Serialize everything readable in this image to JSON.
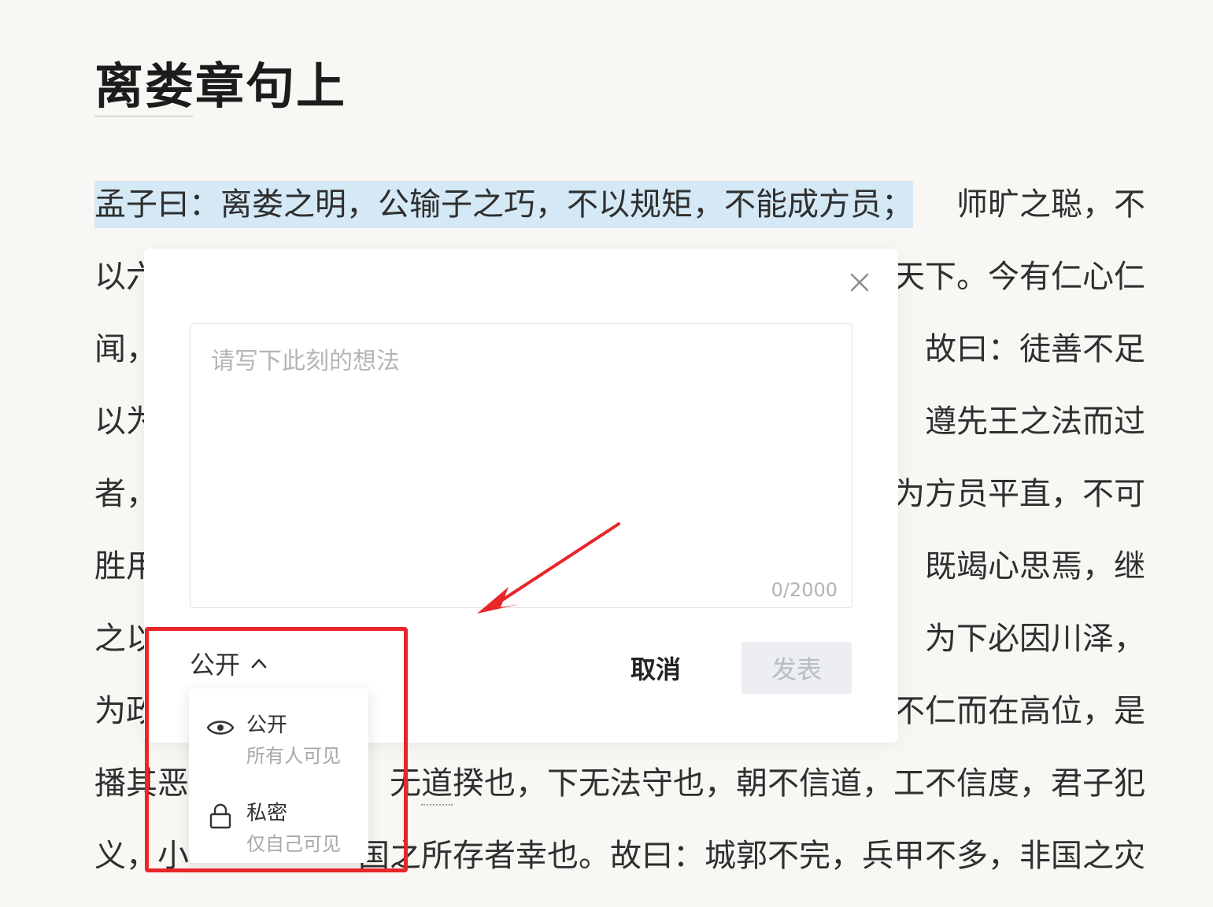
{
  "chapter": {
    "title": "离娄章句上"
  },
  "text_lines": [
    {
      "left": "孟子曰：离娄之明，公输子之巧，不以规矩，不能成方员；",
      "right": "师旷之聪，不"
    },
    {
      "left": "以六",
      "right": "天下。今有仁心仁"
    },
    {
      "left": "闻，",
      "right": "故曰：徒善不足"
    },
    {
      "left": "以为",
      "right": "遵先王之法而过"
    },
    {
      "left": "者，",
      "right": "为方员平直，不可"
    },
    {
      "left": "胜用",
      "right": "既竭心思焉，继"
    },
    {
      "left": "之以",
      "right": "为下必因川泽，"
    },
    {
      "left": "为政",
      "right": "不仁而在高位，是"
    },
    {
      "left": "播其恶",
      "right": "无道揆也，下无法守也，朝不信道，工不信度，君子犯"
    },
    {
      "left": "义，小",
      "right": "国之所存者幸也。故曰：城郭不完，兵甲不多，非国之灾"
    }
  ],
  "comment_dialog": {
    "placeholder": "请写下此刻的想法",
    "char_count": "0/2000",
    "visibility_label": "公开",
    "cancel_label": "取消",
    "publish_label": "发表"
  },
  "visibility_dropdown": {
    "options": [
      {
        "icon": "eye-icon",
        "title": "公开",
        "desc": "所有人可见"
      },
      {
        "icon": "lock-icon",
        "title": "私密",
        "desc": "仅自己可见"
      }
    ]
  },
  "annotation_colors": {
    "box": "#e8262a",
    "arrow": "#e8262a"
  }
}
